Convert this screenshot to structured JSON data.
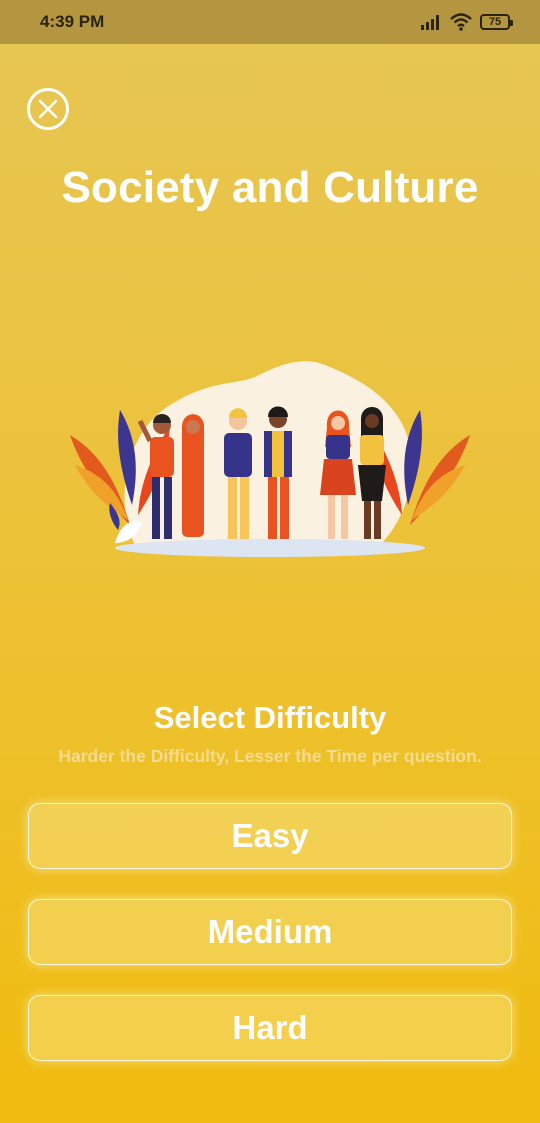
{
  "status_bar": {
    "time": "4:39 PM",
    "battery": "75",
    "icons": [
      "signal-icon",
      "wifi-icon",
      "battery-icon"
    ]
  },
  "close": {
    "icon": "close-icon"
  },
  "topic": {
    "title": "Society and Culture"
  },
  "illustration": {
    "description_icon": "group-of-people-illustration"
  },
  "difficulty": {
    "heading": "Select Difficulty",
    "hint": "Harder the Difficulty, Lesser the Time per question.",
    "options": [
      {
        "label": "Easy"
      },
      {
        "label": "Medium"
      },
      {
        "label": "Hard"
      }
    ]
  },
  "colors": {
    "background_top": "#e6c654",
    "background_bottom": "#f1bc0f",
    "status_bar": "#b3963f",
    "text": "#ffffff",
    "hint_text": "#f3dc90"
  }
}
